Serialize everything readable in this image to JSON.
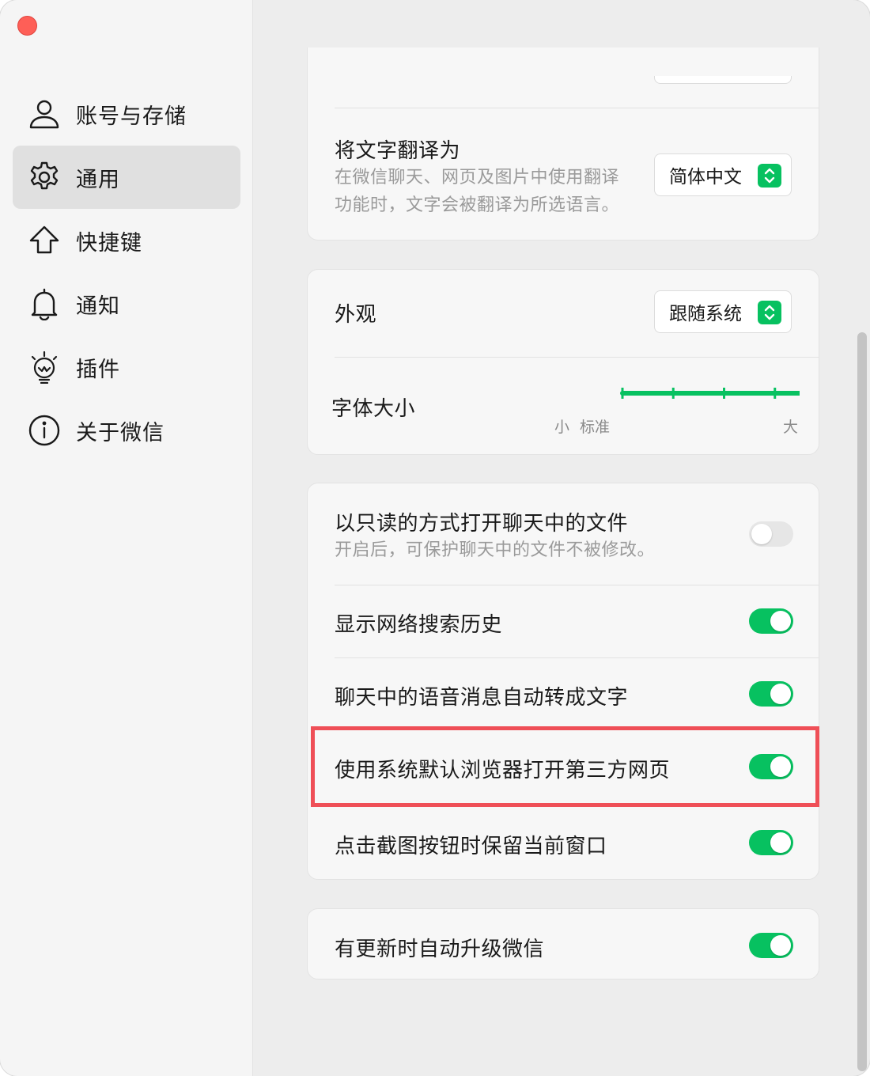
{
  "sidebar": {
    "items": [
      {
        "label": "账号与存储",
        "icon": "user-icon"
      },
      {
        "label": "通用",
        "icon": "gear-icon",
        "active": true
      },
      {
        "label": "快捷键",
        "icon": "shortcut-arrow-icon"
      },
      {
        "label": "通知",
        "icon": "bell-icon"
      },
      {
        "label": "插件",
        "icon": "plugin-icon"
      },
      {
        "label": "关于微信",
        "icon": "info-icon"
      }
    ]
  },
  "translate": {
    "title": "将文字翻译为",
    "sub_line1": "在微信聊天、网页及图片中使用翻译",
    "sub_line2": "功能时，文字会被翻译为所选语言。",
    "value": "简体中文"
  },
  "appearance": {
    "title": "外观",
    "value": "跟随系统"
  },
  "font_size": {
    "title": "字体大小",
    "label_small": "小",
    "label_standard": "标准",
    "label_large": "大",
    "level": 5,
    "steps": 9
  },
  "toggles": {
    "readonly": {
      "title": "以只读的方式打开聊天中的文件",
      "sub": "开启后，可保护聊天中的文件不被修改。",
      "on": false
    },
    "search_history": {
      "title": "显示网络搜索历史",
      "on": true
    },
    "voice_to_text": {
      "title": "聊天中的语音消息自动转成文字",
      "on": true
    },
    "system_browser": {
      "title": "使用系统默认浏览器打开第三方网页",
      "on": true
    },
    "keep_window": {
      "title": "点击截图按钮时保留当前窗口",
      "on": true
    },
    "auto_update": {
      "title": "有更新时自动升级微信",
      "on": true
    }
  },
  "colors": {
    "accent": "#07c160",
    "highlight": "#ef4f57",
    "close": "#fe5f57"
  }
}
